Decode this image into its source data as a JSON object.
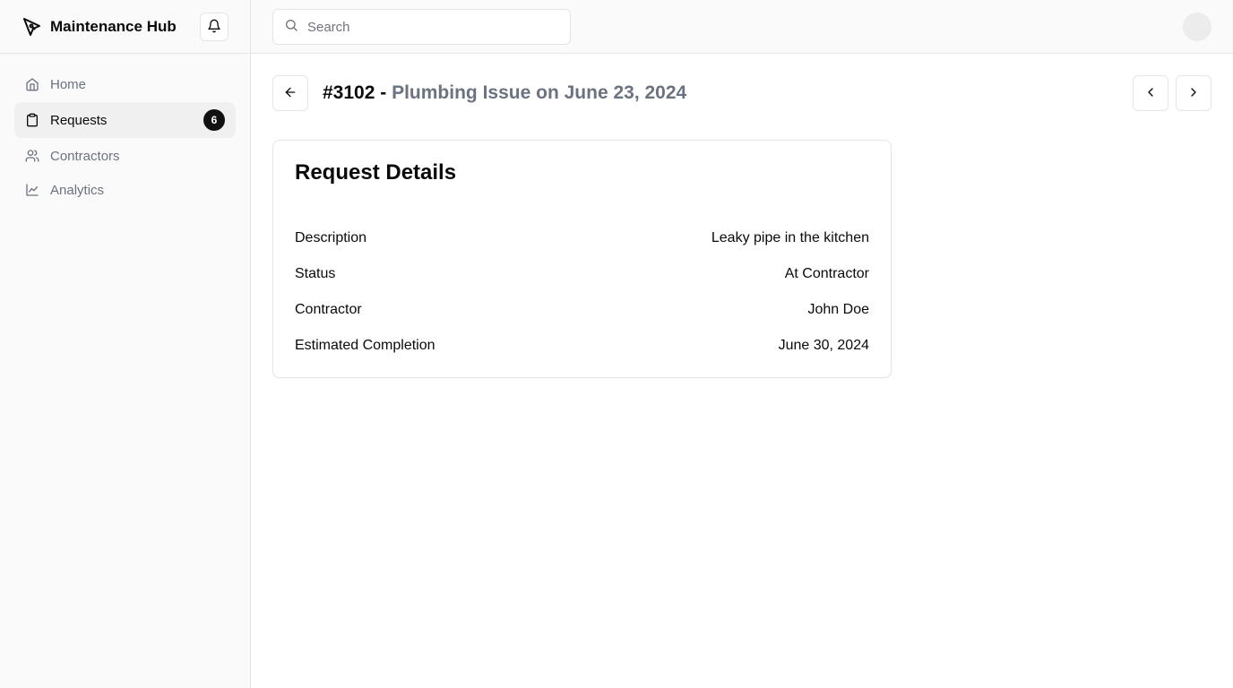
{
  "app": {
    "name": "Maintenance Hub"
  },
  "sidebar": {
    "items": [
      {
        "label": "Home",
        "icon": "home-icon",
        "active": false
      },
      {
        "label": "Requests",
        "icon": "clipboard-icon",
        "active": true,
        "badge": "6"
      },
      {
        "label": "Contractors",
        "icon": "users-icon",
        "active": false
      },
      {
        "label": "Analytics",
        "icon": "line-chart-icon",
        "active": false
      }
    ]
  },
  "search": {
    "placeholder": "Search",
    "value": ""
  },
  "request": {
    "id": "#3102",
    "separator": "-",
    "subtitle": "Plumbing Issue on June 23, 2024"
  },
  "details": {
    "title": "Request Details",
    "rows": [
      {
        "label": "Description",
        "value": "Leaky pipe in the kitchen"
      },
      {
        "label": "Status",
        "value": "At Contractor"
      },
      {
        "label": "Contractor",
        "value": "John Doe"
      },
      {
        "label": "Estimated Completion",
        "value": "June 30, 2024"
      }
    ]
  },
  "colors": {
    "badge_bg": "#111111",
    "muted_text": "#6b7280",
    "border": "#e5e5e5",
    "sidebar_bg": "#fafafa"
  }
}
